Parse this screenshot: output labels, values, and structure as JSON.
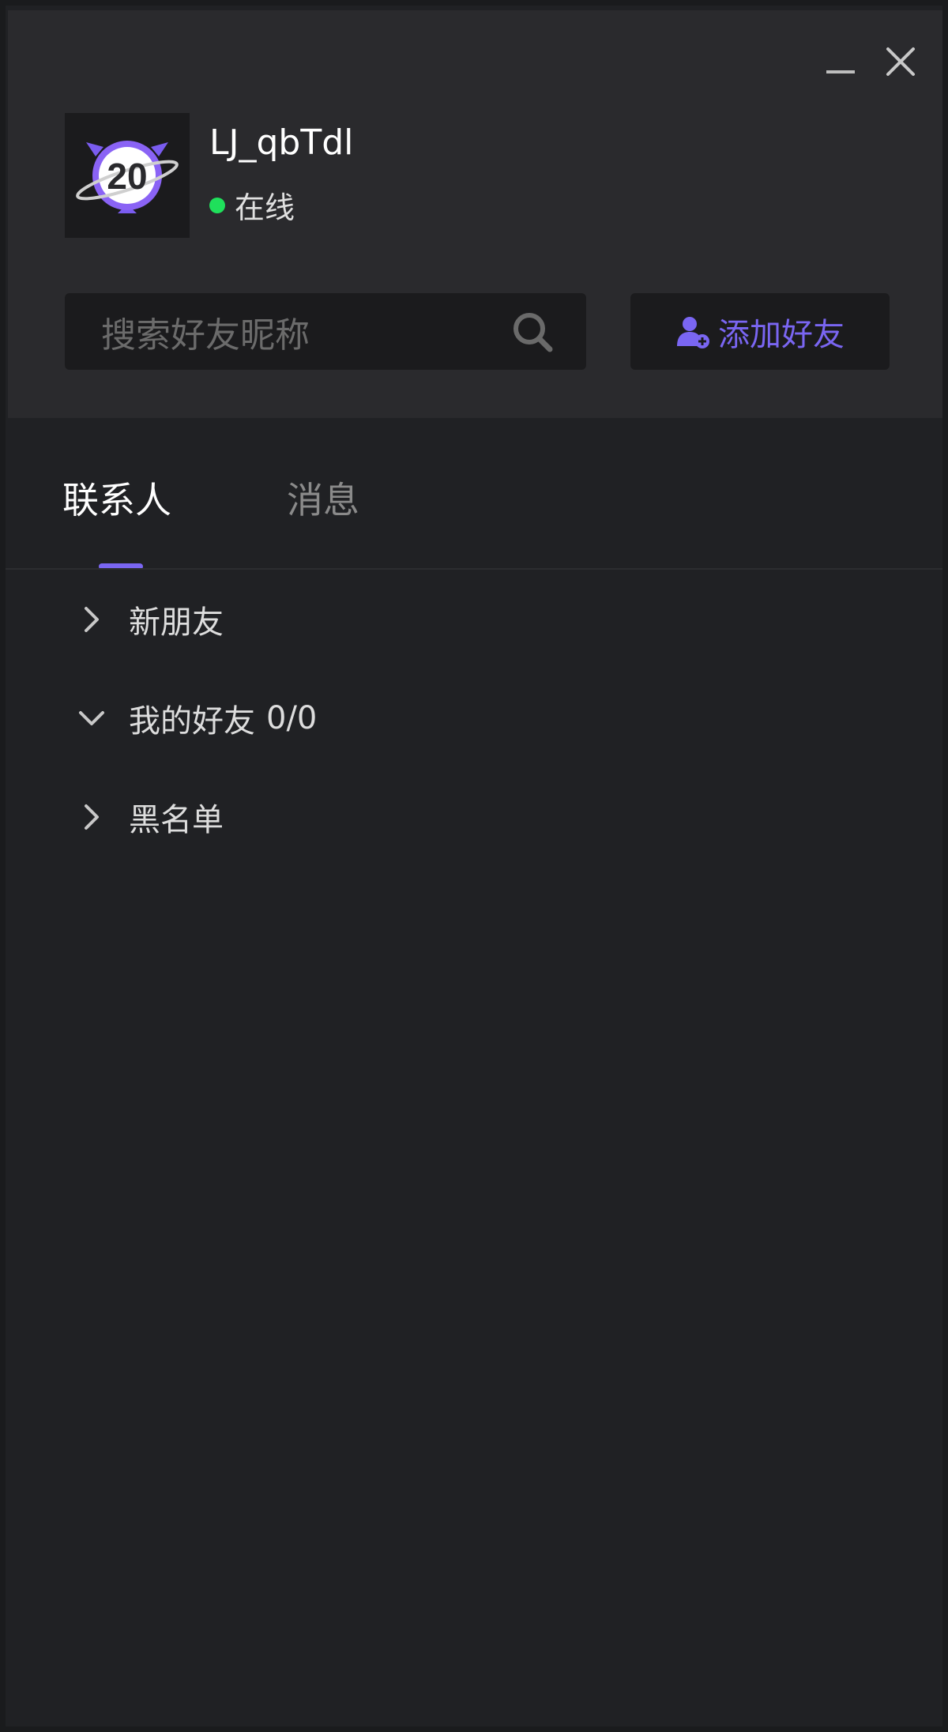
{
  "user": {
    "name": "LJ_qbTdl",
    "status": "在线",
    "status_color": "#1fe05b",
    "avatar_text": "20"
  },
  "search": {
    "placeholder": "搜索好友昵称"
  },
  "add_friend": {
    "label": "添加好友"
  },
  "tabs": [
    {
      "label": "联系人",
      "active": true
    },
    {
      "label": "消息",
      "active": false
    }
  ],
  "groups": [
    {
      "label": "新朋友",
      "count": "",
      "expanded": false
    },
    {
      "label": "我的好友",
      "count": "0/0",
      "expanded": true
    },
    {
      "label": "黑名单",
      "count": "",
      "expanded": false
    }
  ],
  "colors": {
    "accent": "#7a66f2",
    "background": "#202124",
    "header": "#2a2a2d"
  }
}
